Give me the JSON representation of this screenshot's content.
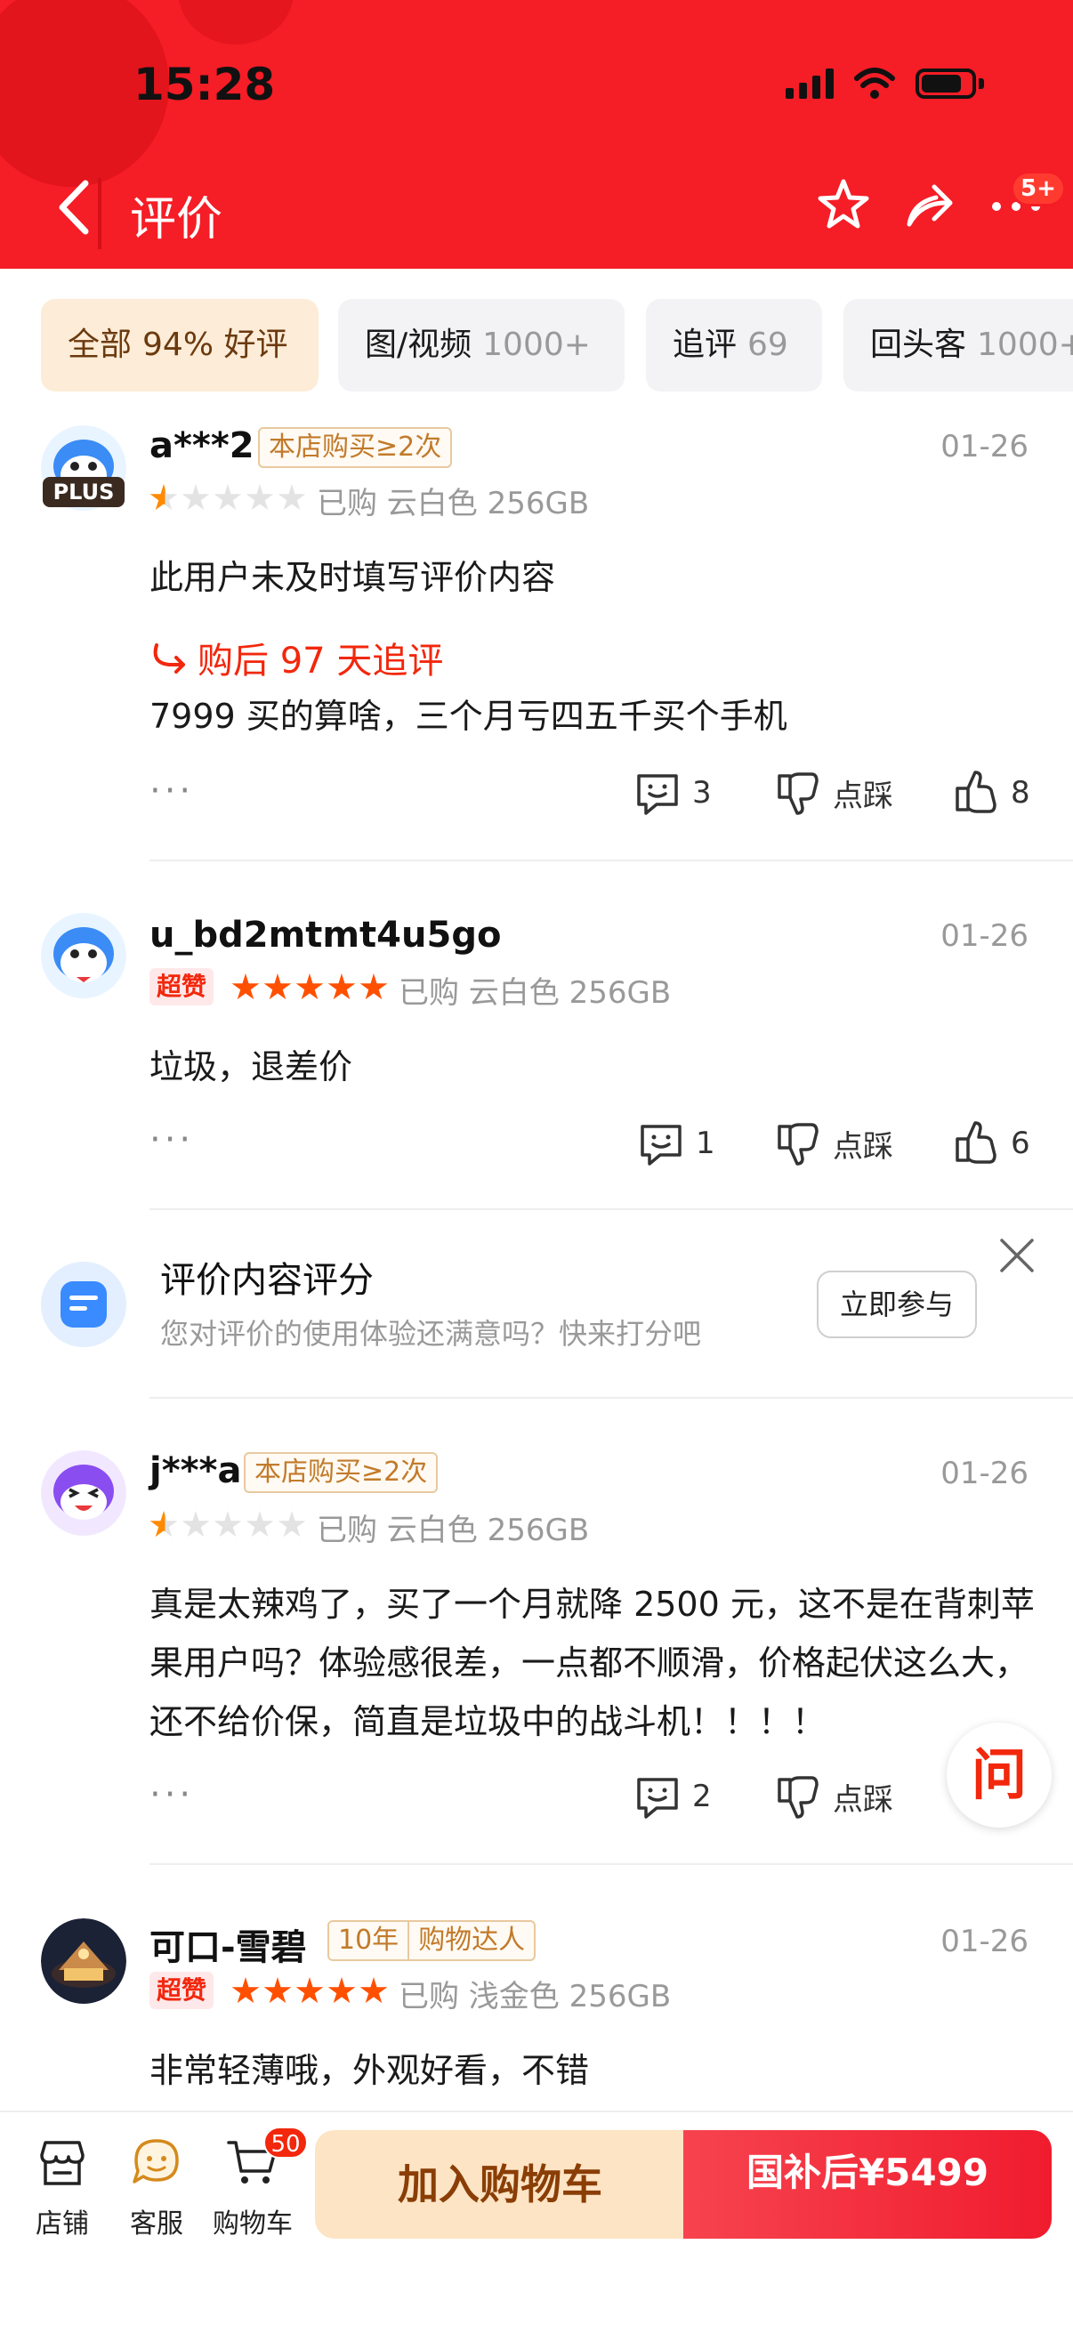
{
  "status_bar": {
    "time": "15:28"
  },
  "nav": {
    "title": "评价",
    "more_badge": "5+"
  },
  "filters": [
    {
      "label": "全部",
      "count": "94% 好评"
    },
    {
      "label": "图/视频",
      "count": "1000+"
    },
    {
      "label": "追评",
      "count": "69"
    },
    {
      "label": "回头客",
      "count": "1000+"
    }
  ],
  "reviews": [
    {
      "username": "a***2",
      "badge": "本店购买≥2次",
      "plus_tag": "PLUS",
      "date": "01-26",
      "rating": 1,
      "purchase": "已购  云白色  256GB",
      "content": "此用户未及时填写评价内容",
      "followup_label": "购后 97 天追评",
      "followup_content": "7999 买的算啥，三个月亏四五千买个手机",
      "more": "···",
      "comments": "3",
      "dislike": "点踩",
      "likes": "8"
    },
    {
      "username": "u_bd2mtmt4u5go",
      "super_tag": "超赞",
      "date": "01-26",
      "rating": 5,
      "purchase": "已购  云白色  256GB",
      "content": "垃圾，退差价",
      "more": "···",
      "comments": "1",
      "dislike": "点踩",
      "likes": "6"
    },
    {
      "username": "j***a",
      "badge": "本店购买≥2次",
      "date": "01-26",
      "rating": 1,
      "purchase": "已购  云白色  256GB",
      "content": "真是太辣鸡了，买了一个月就降 2500 元，这不是在背刺苹果用户吗？体验感很差，一点都不顺滑，价格起伏这么大，还不给价保，简直是垃圾中的战斗机！！！！",
      "more": "···",
      "comments": "2",
      "dislike": "点踩"
    },
    {
      "username": "可口-雪碧",
      "badge_years": "10年",
      "badge": "购物达人",
      "super_tag": "超赞",
      "date": "01-26",
      "rating": 5,
      "purchase": "已购  浅金色  256GB",
      "content": "非常轻薄哦，外观好看，不错"
    }
  ],
  "survey": {
    "title": "评价内容评分",
    "subtitle": "您对评价的使用体验还满意吗？快来打分吧",
    "button": "立即参与"
  },
  "ask_float": "问",
  "bottom_bar": {
    "tabs": [
      {
        "label": "店铺",
        "icon": "store-icon"
      },
      {
        "label": "客服",
        "icon": "customer-service-icon"
      },
      {
        "label": "购物车",
        "icon": "cart-icon",
        "badge": "50"
      }
    ],
    "add_to_cart": "加入购物车",
    "buy_now": "国补后¥5499"
  },
  "colors": {
    "header_red": "#f51d26",
    "accent_red": "#f2270c",
    "star_orange": "#ff5000",
    "cart_button": "#fde4c4"
  }
}
